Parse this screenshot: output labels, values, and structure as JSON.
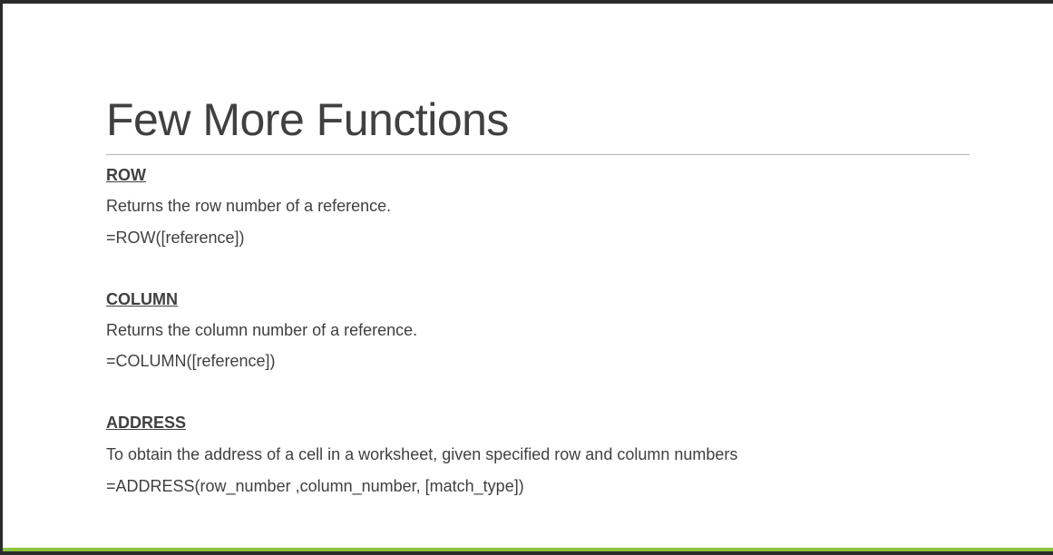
{
  "slide": {
    "title": "Few More Functions",
    "accent_color": "#8dc63f",
    "sections": [
      {
        "heading": "ROW",
        "description": "Returns the row number of a reference.",
        "syntax": "=ROW([reference])"
      },
      {
        "heading": "COLUMN",
        "description": "Returns the column number of a reference.",
        "syntax": "=COLUMN([reference])"
      },
      {
        "heading": "ADDRESS",
        "description": "To obtain the address of a cell in a worksheet, given specified row and column numbers",
        "syntax": "=ADDRESS(row_number ,column_number, [match_type])"
      }
    ]
  }
}
